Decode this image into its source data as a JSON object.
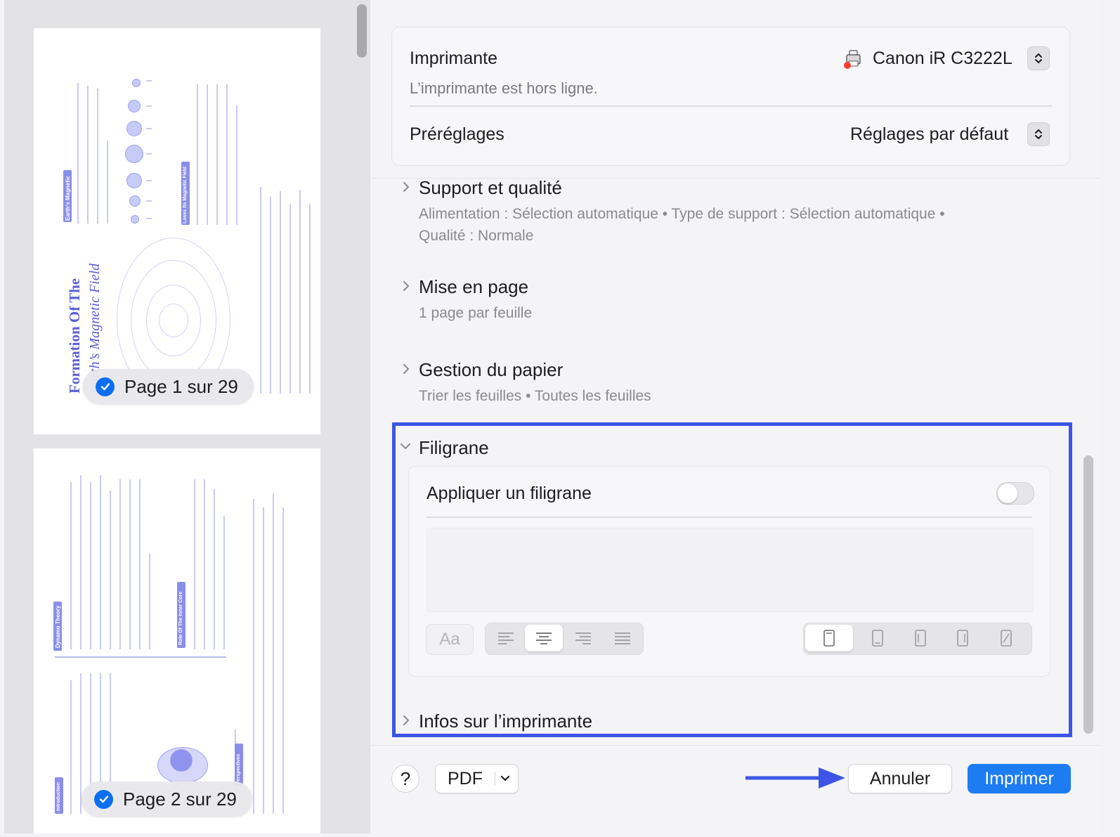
{
  "printer": {
    "label": "Imprimante",
    "name": "Canon iR C3222L",
    "status": "L’imprimante est hors ligne."
  },
  "presets": {
    "label": "Préréglages",
    "value": "Réglages par défaut"
  },
  "sections": {
    "media": {
      "title": "Support et qualité",
      "summary_line1": "Alimentation : Sélection automatique • Type de support : Sélection automatique •",
      "summary_line2": "Qualité : Normale"
    },
    "layout": {
      "title": "Mise en page",
      "summary": "1 page par feuille"
    },
    "paper": {
      "title": "Gestion du papier",
      "summary": "Trier les feuilles • Toutes les feuilles"
    },
    "watermark": {
      "title": "Filigrane",
      "apply_label": "Appliquer un filigrane",
      "apply_on": false,
      "text_value": "",
      "font_button": "Aa",
      "alignment_selected": "center",
      "orientation_selected": "portrait"
    },
    "printer_info": {
      "title": "Infos sur l’imprimante"
    }
  },
  "footer": {
    "help": "?",
    "pdf": "PDF",
    "cancel": "Annuler",
    "print": "Imprimer"
  },
  "preview": {
    "page1_label": "Page 1 sur 29",
    "page2_label": "Page 2 sur 29",
    "page1": {
      "title_line1": "Formation Of The",
      "title_line2": "Earth’s Magnetic Field",
      "heading_earth": "Earth's Magnetic",
      "heading_loses": "Loses Its Magnetic Field"
    },
    "page2": {
      "heading_dynamo": "Dynamo Theory",
      "heading_inner_core": "Role Of The Inner Core",
      "heading_intro": "Introduction",
      "heading_perspectives": "Perspectives"
    }
  },
  "colors": {
    "accent": "#1d7cf2",
    "highlight_border": "#3d55e6",
    "offline_dot": "#ff3b30",
    "preview_text": "#5b5fd6"
  }
}
